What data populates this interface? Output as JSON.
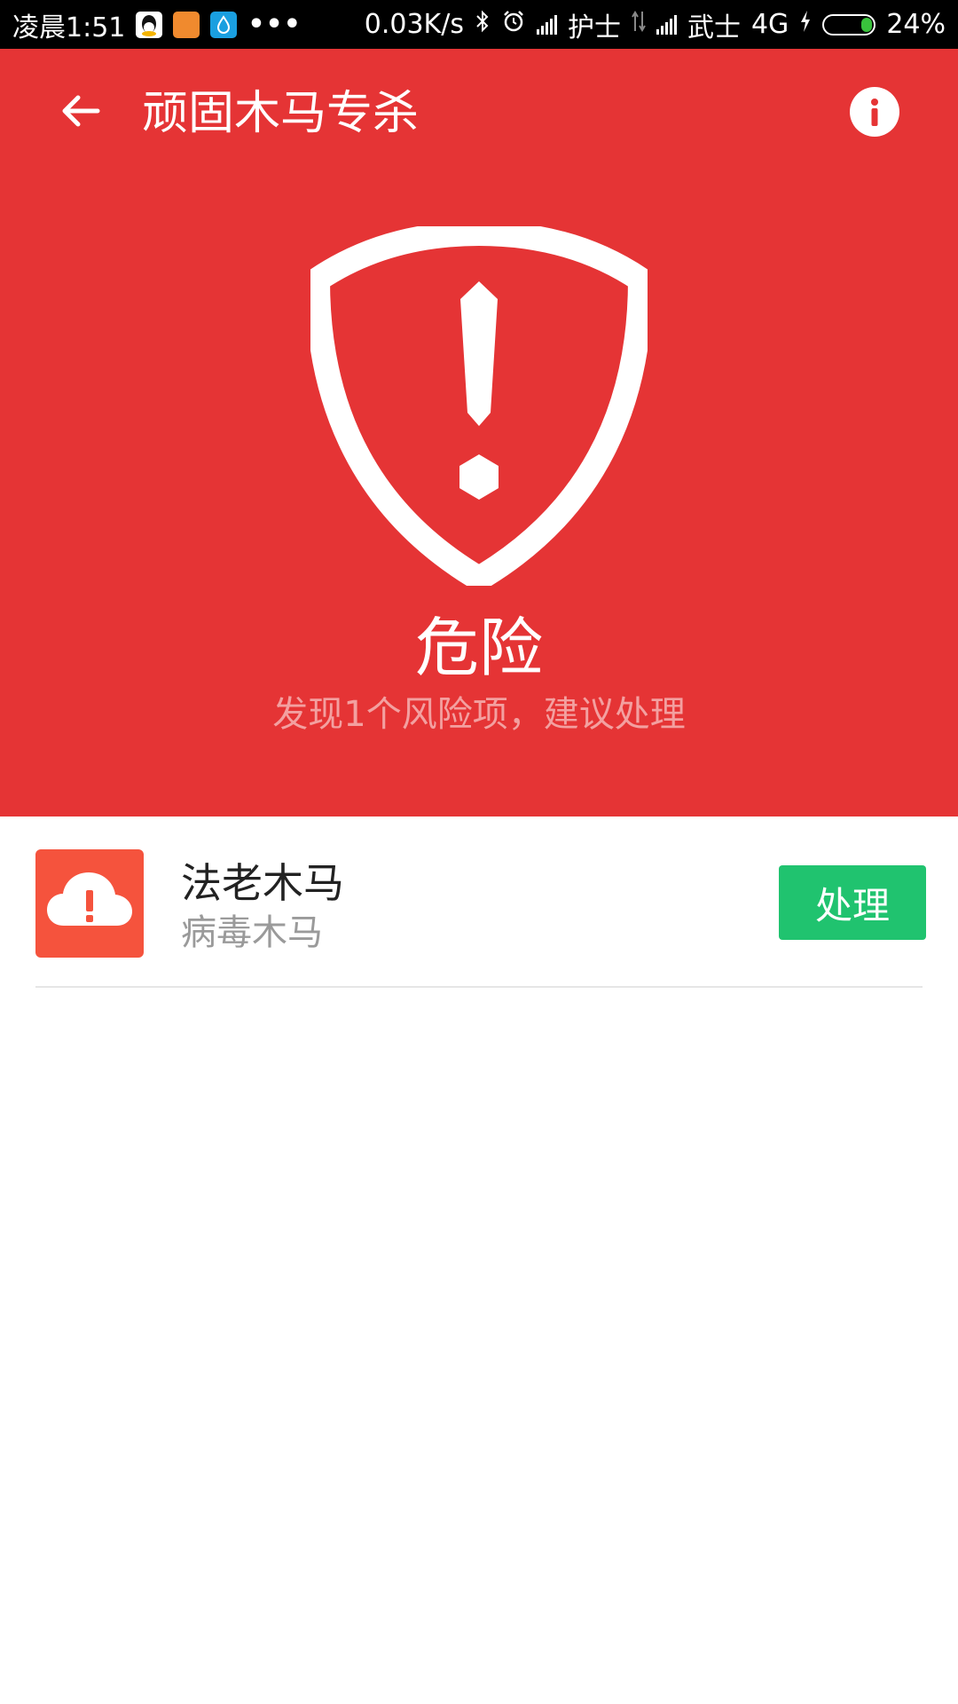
{
  "status_bar": {
    "time": "凌晨1:51",
    "net_speed": "0.03K/s",
    "carrier1": "护士",
    "carrier2": "武士",
    "network": "4G",
    "battery": "24%",
    "battery_level": 0.24,
    "app_icons": [
      "qq-icon",
      "taobao-icon",
      "water-drop-app-icon"
    ],
    "overflow": "•••"
  },
  "header": {
    "title": "顽固木马专杀"
  },
  "scan_result": {
    "status": "危险",
    "summary": "发现1个风险项，建议处理"
  },
  "threats": [
    {
      "name": "法老木马",
      "type": "病毒木马",
      "action_label": "处理"
    }
  ],
  "colors": {
    "danger_red": "#e53435",
    "action_green": "#20c36f",
    "threat_icon_bg": "#f5533d"
  }
}
